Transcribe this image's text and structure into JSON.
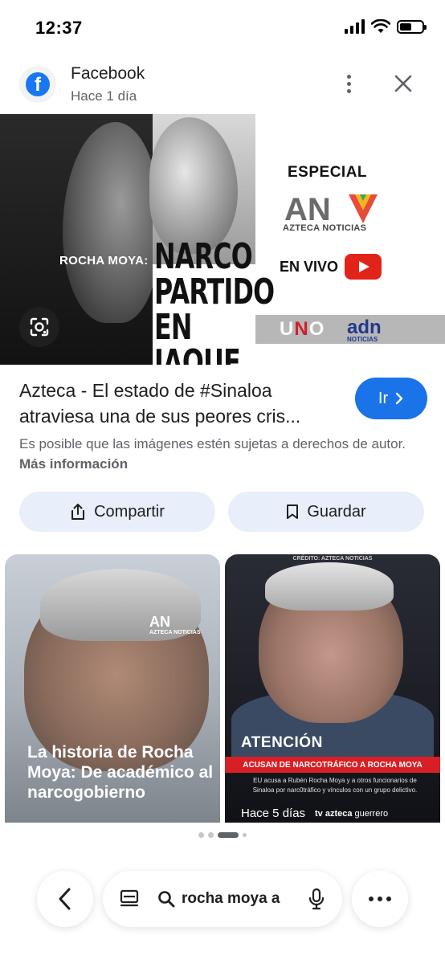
{
  "status_bar": {
    "time": "12:37"
  },
  "source": {
    "name": "Facebook",
    "time": "Hace 1 día",
    "logo_letter": "f"
  },
  "main_image": {
    "left_label": "ROCHA MOYA:",
    "headline_lines": [
      "NARCO",
      "PARTIDO",
      "EN JAQUE"
    ],
    "especial": "ESPECIAL",
    "logo_text": "AN",
    "logo_sub": "AZTECA NOTICIAS",
    "envivo": "EN VIVO",
    "uno_logo_a": "U",
    "uno_logo_n": "N",
    "uno_logo_o": "O",
    "adn_logo": "adn",
    "adn_sub": "NOTICIAS"
  },
  "caption": {
    "title": "Azteca - El estado de #Sinaloa atraviesa una de sus peores cris...",
    "go_label": "Ir",
    "copyright_text": "Es posible que las imágenes estén sujetas a derechos de autor. ",
    "more_info": "Más información"
  },
  "actions": {
    "share_label": "Compartir",
    "save_label": "Guardar"
  },
  "related": [
    {
      "logo_text": "AN",
      "logo_sub": "AZTECA NOTICIAS",
      "text": "La historia de Rocha Moya: De académico al narcogobierno"
    },
    {
      "credit": "CRÉDITO: AZTECA NOTICIAS",
      "title": "ATENCIÓN",
      "banner": "ACUSAN DE NARCOTRÁFICO A ROCHA MOYA",
      "body": "EU acusa a Rubén Rocha Moya y a otros funcionarios de Sinaloa por narc0tráfico y vínculos con un grupo delictivo.",
      "time": "Hace 5 días",
      "brand_bold": "tv azteca",
      "brand_light": " guerrero"
    }
  ],
  "pager": {
    "active_index": 2,
    "count": 4
  },
  "search": {
    "query": "rocha moya a"
  },
  "colors": {
    "accent": "#1a73e8",
    "facebook": "#1877f2",
    "pill_bg": "#e8eefa",
    "banner_red": "#d81f26"
  },
  "icons": {
    "close": "close-icon",
    "menu": "more-vert-icon",
    "lens": "google-lens-icon",
    "share": "share-icon",
    "bookmark": "bookmark-icon",
    "back": "chevron-left-icon",
    "tabs": "tabs-icon",
    "search": "search-icon",
    "mic": "mic-icon",
    "more": "more-horiz-icon"
  }
}
